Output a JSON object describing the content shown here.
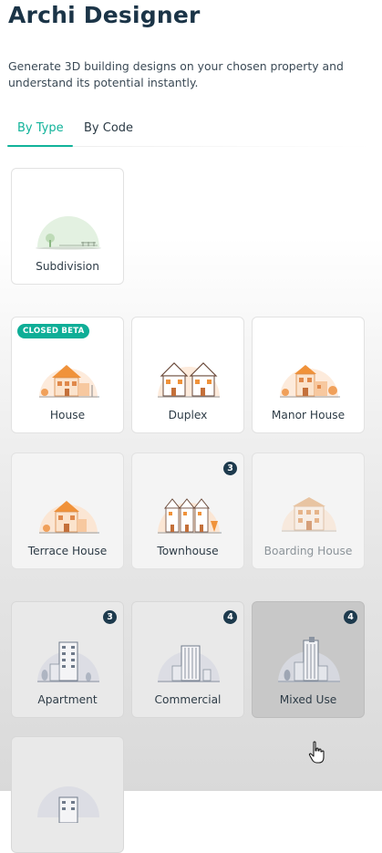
{
  "header": {
    "title": "Archi Designer",
    "subtitle": "Generate 3D building designs on your chosen property and understand its potential instantly."
  },
  "tabs": [
    {
      "label": "By Type",
      "active": true
    },
    {
      "label": "By Code",
      "active": false
    }
  ],
  "colors": {
    "accent": "#11b39a",
    "badge": "#1d3a4d",
    "house_orange": "#f0923a",
    "tower_gray": "#6f7a8a"
  },
  "cards": [
    {
      "label": "Subdivision",
      "icon": "subdivision-icon"
    },
    {
      "label": "House",
      "icon": "house-icon",
      "tag": "CLOSED BETA"
    },
    {
      "label": "Duplex",
      "icon": "duplex-icon"
    },
    {
      "label": "Manor House",
      "icon": "manor-house-icon"
    },
    {
      "label": "Terrace House",
      "icon": "terrace-house-icon"
    },
    {
      "label": "Townhouse",
      "icon": "townhouse-icon",
      "count": "3"
    },
    {
      "label": "Boarding House",
      "icon": "boarding-house-icon"
    },
    {
      "label": "Apartment",
      "icon": "apartment-icon",
      "count": "3"
    },
    {
      "label": "Commercial",
      "icon": "commercial-icon",
      "count": "4"
    },
    {
      "label": "Mixed Use",
      "icon": "mixed-use-icon",
      "count": "4"
    },
    {
      "label": "",
      "icon": "building-icon"
    }
  ]
}
